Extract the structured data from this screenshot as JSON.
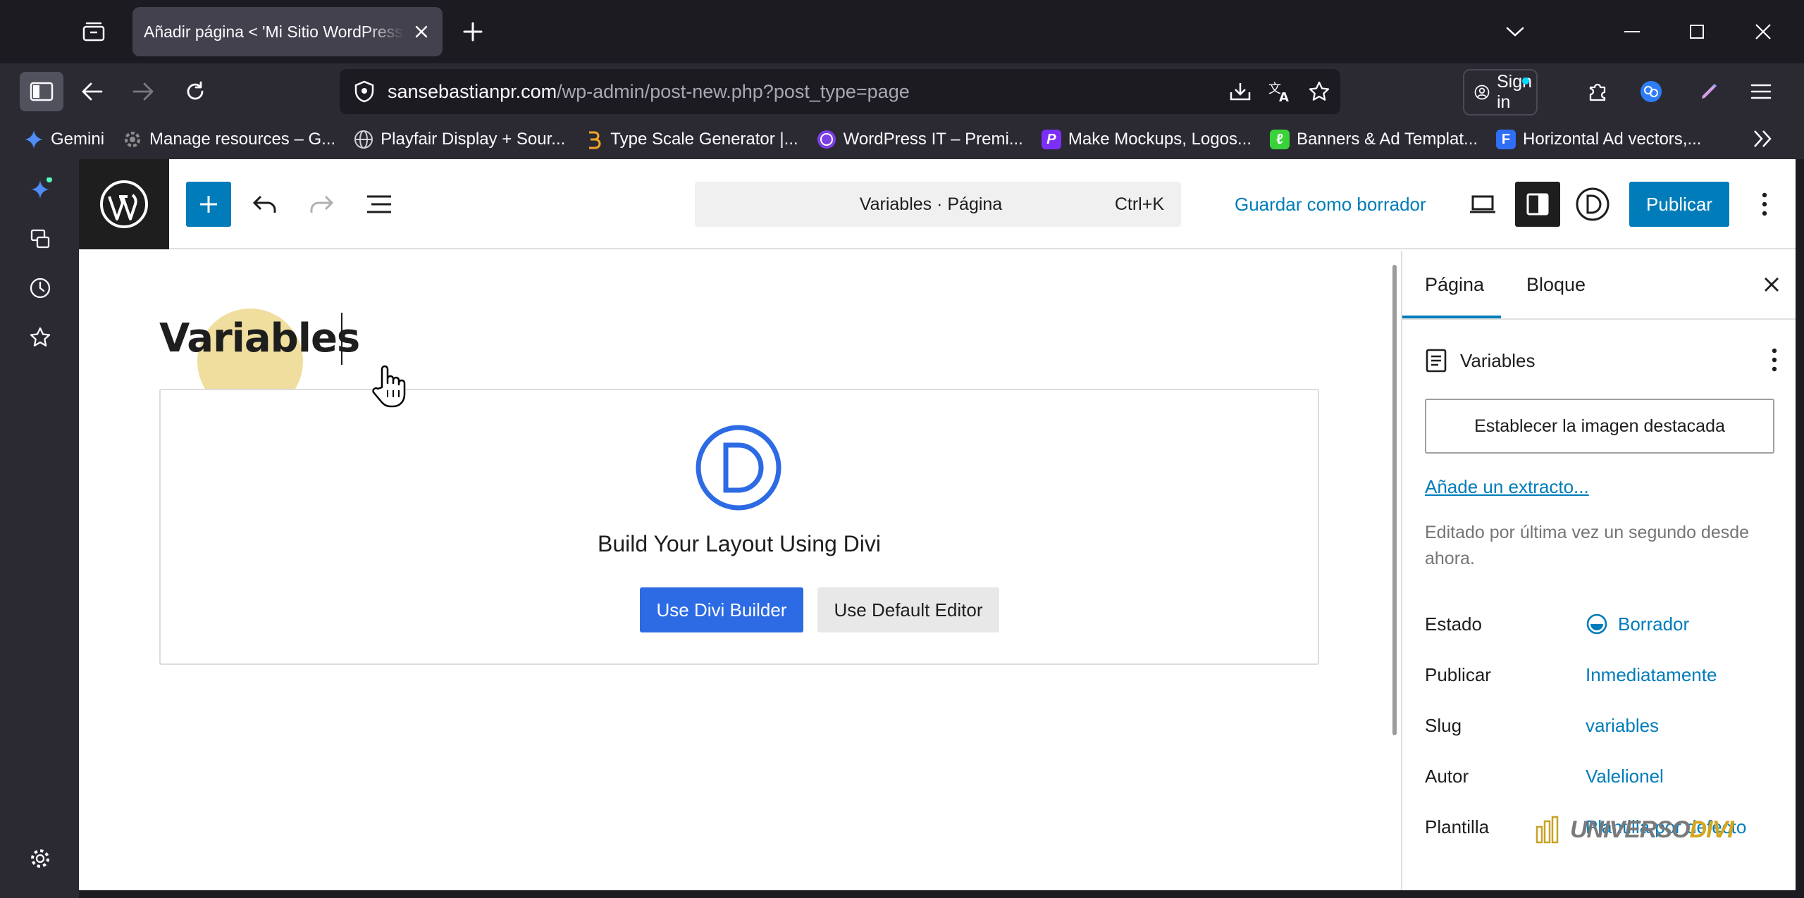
{
  "browser": {
    "tab_title": "Añadir página < 'Mi Sitio WordPress",
    "url_host": "sansebastianpr.com",
    "url_path": "/wp-admin/post-new.php?post_type=page",
    "signin_label": "Sign in",
    "bookmarks": [
      {
        "label": "Gemini",
        "icon": "gemini-icon",
        "color": "#4f8df5"
      },
      {
        "label": "Manage resources – G...",
        "icon": "gear-icon",
        "color": "#8c8c8c"
      },
      {
        "label": "Playfair Display + Sour...",
        "icon": "globe-icon",
        "color": "#cfcfd8"
      },
      {
        "label": "Type Scale Generator |...",
        "icon": "type-scale-icon",
        "color": "#f5a623"
      },
      {
        "label": "WordPress IT – Premi...",
        "icon": "wordpress-it-icon",
        "color": "#7b3fe4"
      },
      {
        "label": "Make Mockups, Logos...",
        "icon": "placeit-icon",
        "color": "#7b2ff7"
      },
      {
        "label": "Banners & Ad Templat...",
        "icon": "banners-icon",
        "color": "#3ad23a"
      },
      {
        "label": "Horizontal Ad vectors,...",
        "icon": "freepik-icon",
        "color": "#2f6ef5"
      }
    ]
  },
  "editor": {
    "command_title": "Variables · Página",
    "command_shortcut": "Ctrl+K",
    "save_draft": "Guardar como borrador",
    "publish": "Publicar",
    "post_title": "Variables",
    "divi_heading": "Build Your Layout Using Divi",
    "use_divi": "Use Divi Builder",
    "use_default": "Use Default Editor",
    "divi_color": "#2d6be4"
  },
  "settings": {
    "tab_page": "Página",
    "tab_block": "Bloque",
    "doc_title": "Variables",
    "featured_image": "Establecer la imagen destacada",
    "excerpt": "Añade un extracto...",
    "edited": "Editado por última vez un segundo desde ahora.",
    "rows": [
      {
        "label": "Estado",
        "value": "Borrador"
      },
      {
        "label": "Publicar",
        "value": "Inmediatamente"
      },
      {
        "label": "Slug",
        "value": "variables"
      },
      {
        "label": "Autor",
        "value": "Valelionel"
      },
      {
        "label": "Plantilla",
        "value": "Plantilla por defecto"
      }
    ]
  },
  "watermark": {
    "part1": "UNIVERSO",
    "part2": "DIVI"
  }
}
